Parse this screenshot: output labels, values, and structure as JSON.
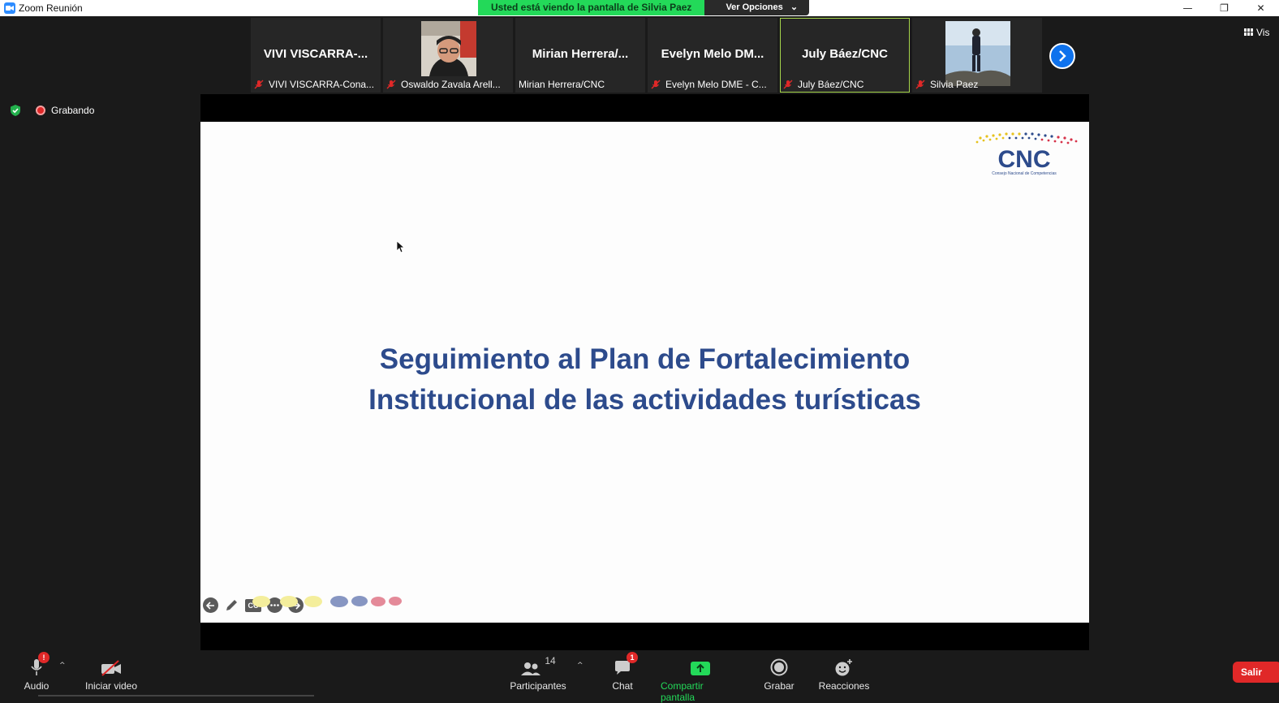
{
  "window": {
    "title": "Zoom Reunión",
    "controls": [
      "—",
      "❐",
      "✕"
    ]
  },
  "share_banner": {
    "message": "Usted está viendo la pantalla de Silvia Paez",
    "options_label": "Ver Opciones",
    "options_caret": "⌄"
  },
  "participants": [
    {
      "display": "VIVI VISCARRA-...",
      "label": "VIVI VISCARRA-Cona...",
      "muted": true,
      "video": false
    },
    {
      "display": "",
      "label": "Oswaldo Zavala Arell...",
      "muted": true,
      "video": true
    },
    {
      "display": "Mirian Herrera/...",
      "label": "Mirian Herrera/CNC",
      "muted": false,
      "video": false
    },
    {
      "display": "Evelyn Melo DM...",
      "label": "Evelyn Melo DME - C...",
      "muted": true,
      "video": false
    },
    {
      "display": "July Báez/CNC",
      "label": "July Báez/CNC",
      "muted": true,
      "video": false,
      "active": true
    },
    {
      "display": "",
      "label": "Silvia Paez",
      "muted": true,
      "video": true
    }
  ],
  "view_button": {
    "label": "Vis"
  },
  "recording": {
    "label": "Grabando"
  },
  "slide": {
    "title_line1": "Seguimiento al Plan de Fortalecimiento",
    "title_line2": "Institucional de las actividades turísticas",
    "logo_text": "CNC",
    "logo_subtext": "Consejo Nacional de Competencias"
  },
  "slide_tools": {
    "cc_label": "CC"
  },
  "toolbar": {
    "audio": {
      "label": "Audio",
      "badge": "!"
    },
    "video": {
      "label": "Iniciar video"
    },
    "participants": {
      "label": "Participantes",
      "count": "14"
    },
    "chat": {
      "label": "Chat",
      "badge": "1"
    },
    "share": {
      "label": "Compartir pantalla"
    },
    "record": {
      "label": "Grabar"
    },
    "reactions": {
      "label": "Reacciones"
    },
    "leave": {
      "label": "Salir"
    },
    "caret": "^"
  },
  "colors": {
    "accent_blue": "#2d8cff",
    "share_green": "#23d959",
    "leave_red": "#e02828",
    "slide_title": "#2d4b8c",
    "active_tile_border": "#a6d64b"
  }
}
